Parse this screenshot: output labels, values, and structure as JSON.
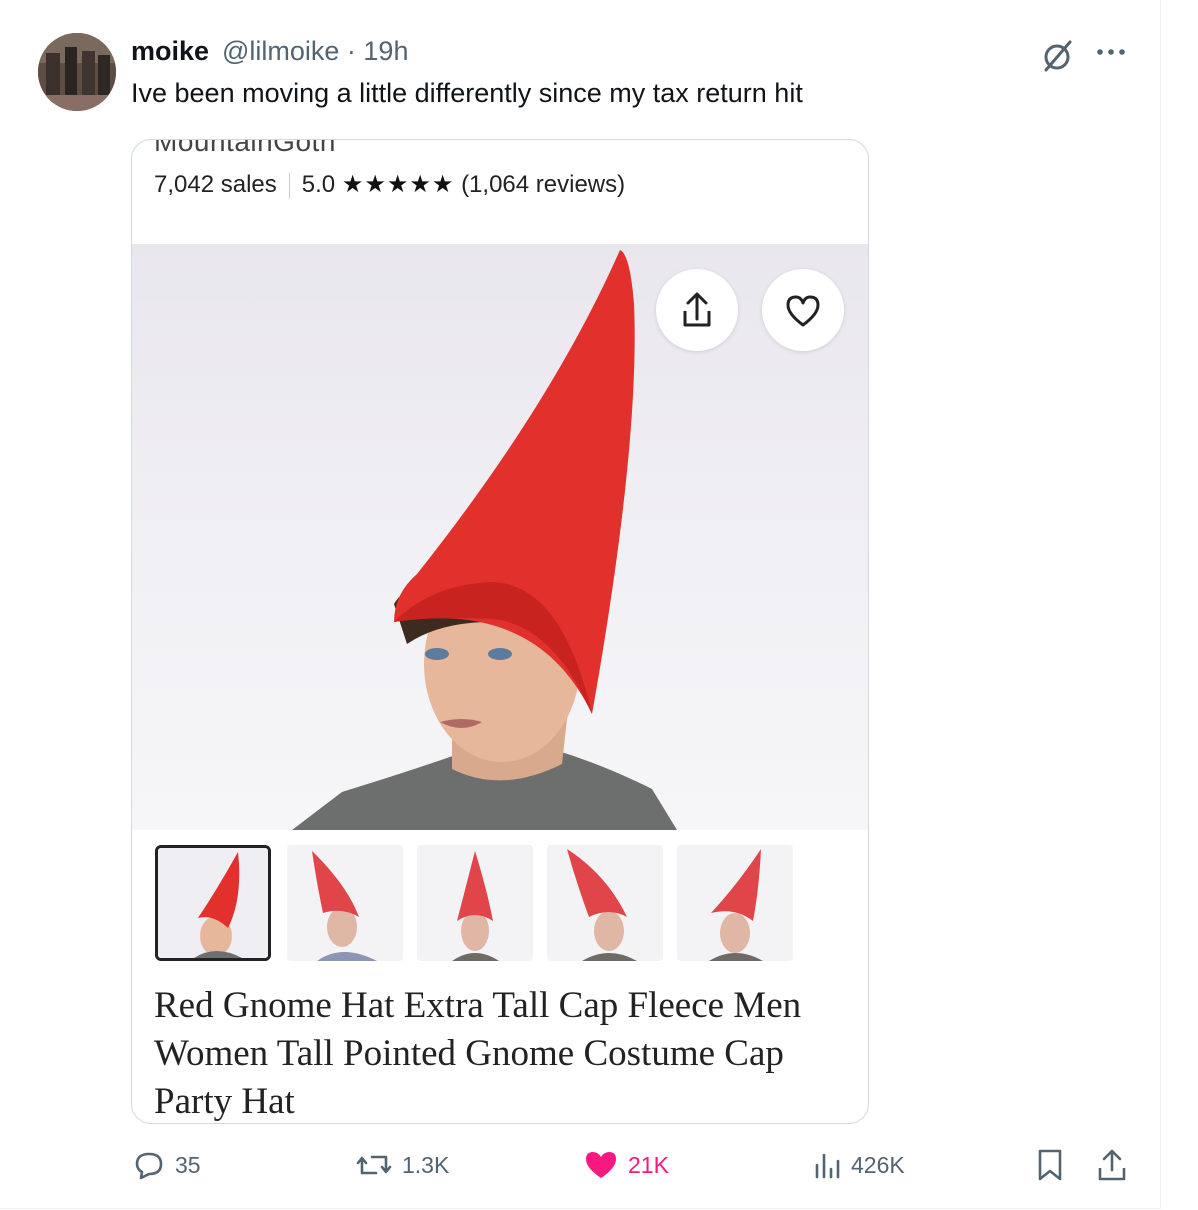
{
  "tweet": {
    "author_name": "moike",
    "handle_time": "@lilmoike · 19h",
    "text": "Ive been moving a little differently since my tax return hit"
  },
  "listing": {
    "shop_name": "MountainGoth",
    "sales": "7,042 sales",
    "rating": "5.0",
    "stars": "★★★★★",
    "reviews": "(1,064 reviews)",
    "title": "Red Gnome Hat Extra Tall Cap Fleece Men Women Tall Pointed Gnome Costume Cap Party Hat"
  },
  "actions": {
    "replies": "35",
    "reposts": "1.3K",
    "likes": "21K",
    "views": "426K"
  },
  "colors": {
    "like_pink": "#f91880",
    "hat_red": "#e2312d",
    "muted": "#536471"
  },
  "icons": [
    "grok-icon",
    "more-icon",
    "share-icon",
    "heart-icon",
    "reply-icon",
    "repost-icon",
    "views-icon",
    "bookmark-icon"
  ]
}
